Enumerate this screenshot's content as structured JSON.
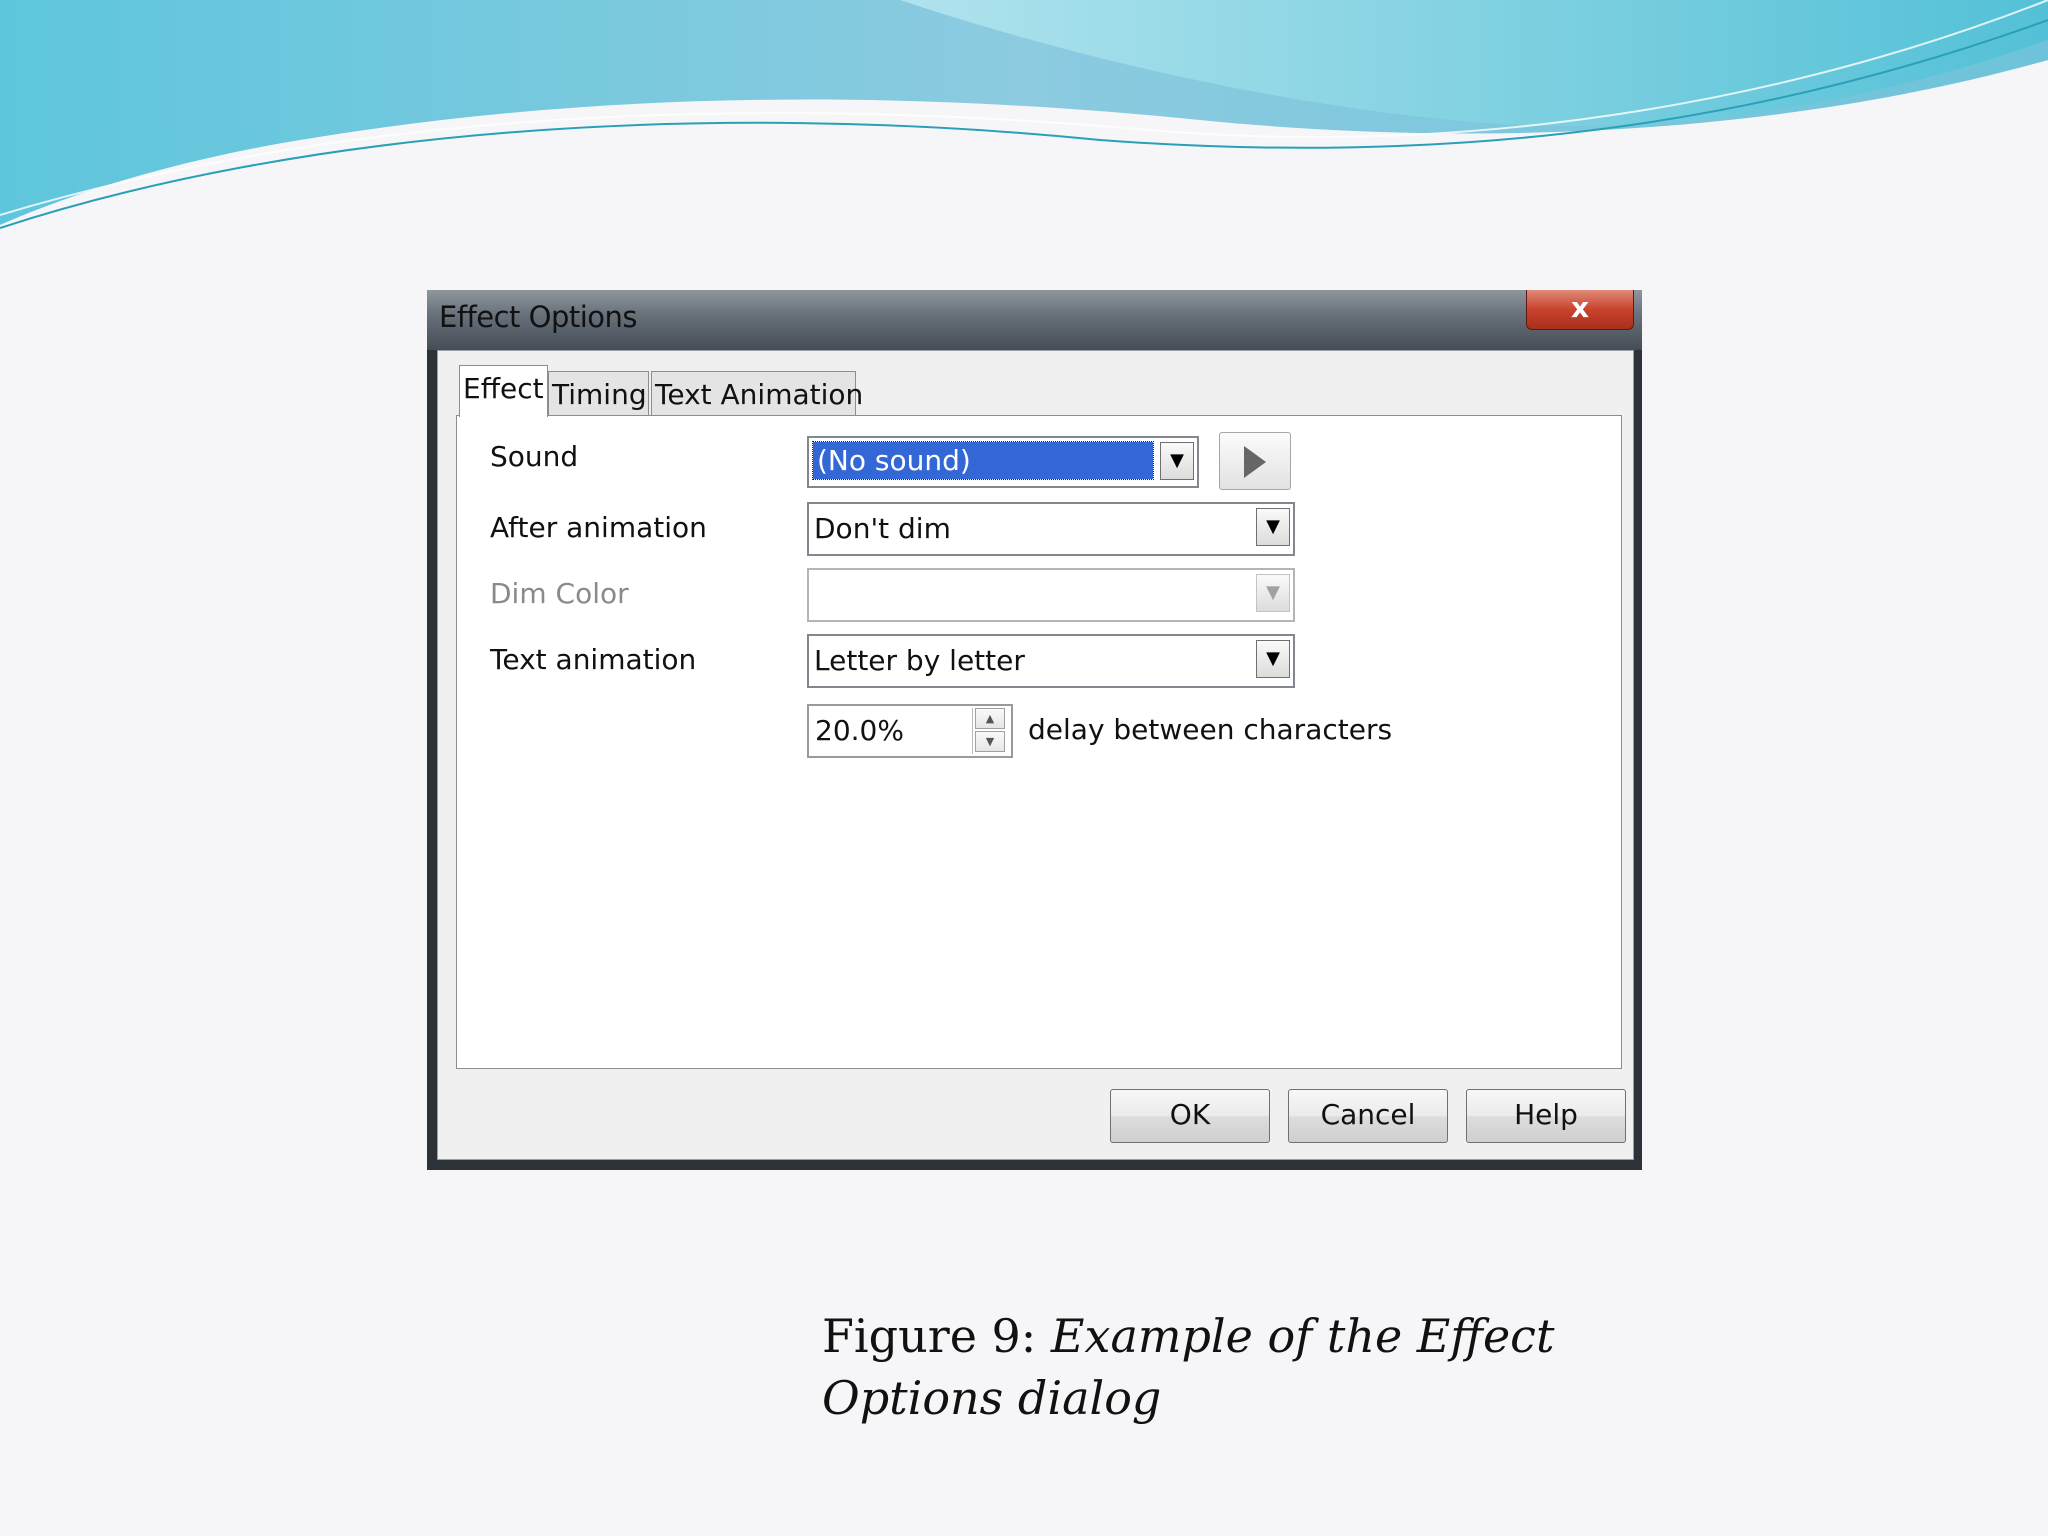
{
  "dialog": {
    "title": "Effect Options",
    "close_glyph": "x",
    "tabs": [
      {
        "label": "Effect",
        "active": true
      },
      {
        "label": "Timing",
        "active": false
      },
      {
        "label": "Text Animation",
        "active": false
      }
    ],
    "fields": {
      "sound": {
        "label": "Sound",
        "value": "(No sound)",
        "selected": true
      },
      "after_animation": {
        "label": "After animation",
        "value": "Don't dim"
      },
      "dim_color": {
        "label": "Dim Color",
        "value": "",
        "disabled": true
      },
      "text_animation": {
        "label": "Text animation",
        "value": "Letter by letter"
      },
      "delay": {
        "value": "20.0%",
        "suffix": "delay between characters"
      }
    },
    "buttons": {
      "ok": "OK",
      "cancel": "Cancel",
      "help": "Help"
    },
    "icons": {
      "play": "play-icon",
      "dropdown": "chevron-down-icon",
      "spin_up": "spin-up-icon",
      "spin_down": "spin-down-icon"
    }
  },
  "caption": {
    "prefix": "Figure 9: ",
    "text": "Example of the Effect Options dialog"
  },
  "colors": {
    "selection": "#3367d6",
    "close_button": "#c8432d",
    "titlebar": "#454c54"
  }
}
